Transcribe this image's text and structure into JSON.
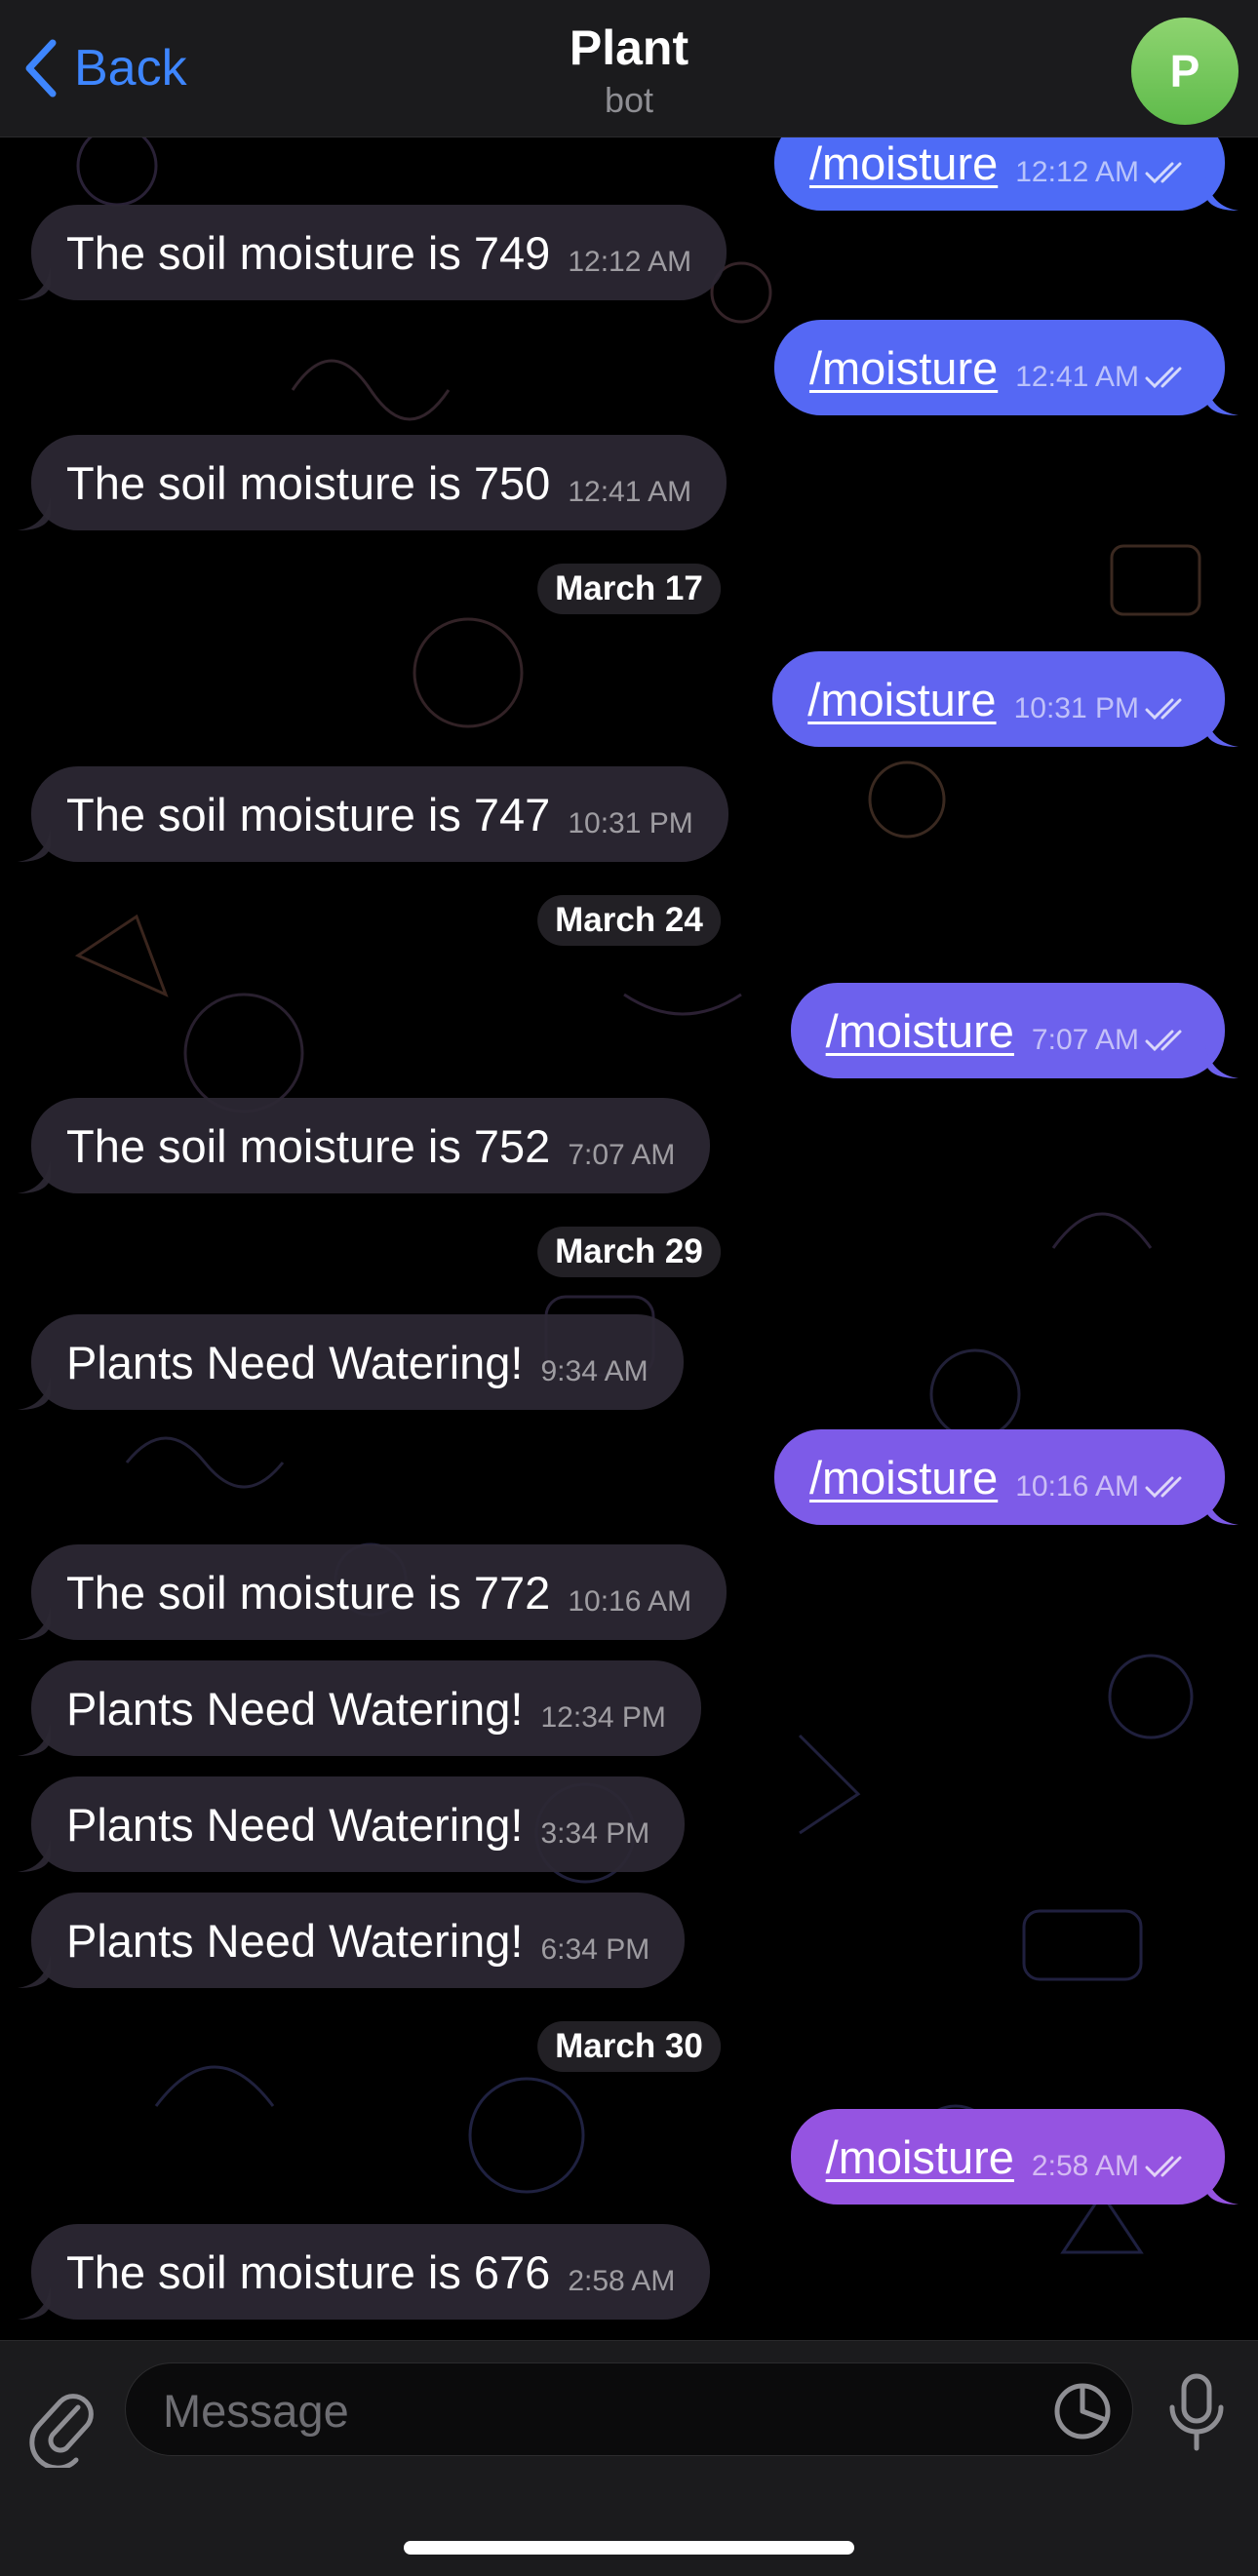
{
  "header": {
    "back_label": "Back",
    "title": "Plant",
    "subtitle": "bot",
    "avatar_letter": "P",
    "avatar_color": "#6cc35a"
  },
  "messages": [
    {
      "kind": "out",
      "text": "/moisture",
      "time": "12:12 AM"
    },
    {
      "kind": "in",
      "text": "The soil moisture is 749",
      "time": "12:12 AM"
    },
    {
      "kind": "out",
      "text": "/moisture",
      "time": "12:41 AM"
    },
    {
      "kind": "in",
      "text": "The soil moisture is 750",
      "time": "12:41 AM"
    },
    {
      "kind": "date",
      "text": "March 17"
    },
    {
      "kind": "out",
      "text": "/moisture",
      "time": "10:31 PM"
    },
    {
      "kind": "in",
      "text": "The soil moisture is 747",
      "time": "10:31 PM"
    },
    {
      "kind": "date",
      "text": "March 24"
    },
    {
      "kind": "out",
      "text": "/moisture",
      "time": "7:07 AM"
    },
    {
      "kind": "in",
      "text": "The soil moisture is 752",
      "time": "7:07 AM"
    },
    {
      "kind": "date",
      "text": "March 29"
    },
    {
      "kind": "in",
      "text": "Plants Need Watering!",
      "time": "9:34 AM"
    },
    {
      "kind": "out",
      "text": "/moisture",
      "time": "10:16 AM"
    },
    {
      "kind": "in",
      "text": "The soil moisture is 772",
      "time": "10:16 AM"
    },
    {
      "kind": "in",
      "text": "Plants Need Watering!",
      "time": "12:34 PM"
    },
    {
      "kind": "in",
      "text": "Plants Need Watering!",
      "time": "3:34 PM"
    },
    {
      "kind": "in",
      "text": "Plants Need Watering!",
      "time": "6:34 PM"
    },
    {
      "kind": "date",
      "text": "March 30"
    },
    {
      "kind": "out",
      "text": "/moisture",
      "time": "2:58 AM"
    },
    {
      "kind": "in",
      "text": "The soil moisture is 676",
      "time": "2:58 AM"
    }
  ],
  "composer": {
    "placeholder": "Message",
    "attach_icon": "paperclip-icon",
    "sticker_icon": "sticker-icon",
    "mic_icon": "microphone-icon"
  },
  "colors": {
    "outgoing_top": "#4a6cf7",
    "outgoing_bottom": "#9a52e0",
    "incoming": "#2c2834",
    "accent": "#3e86ff"
  }
}
